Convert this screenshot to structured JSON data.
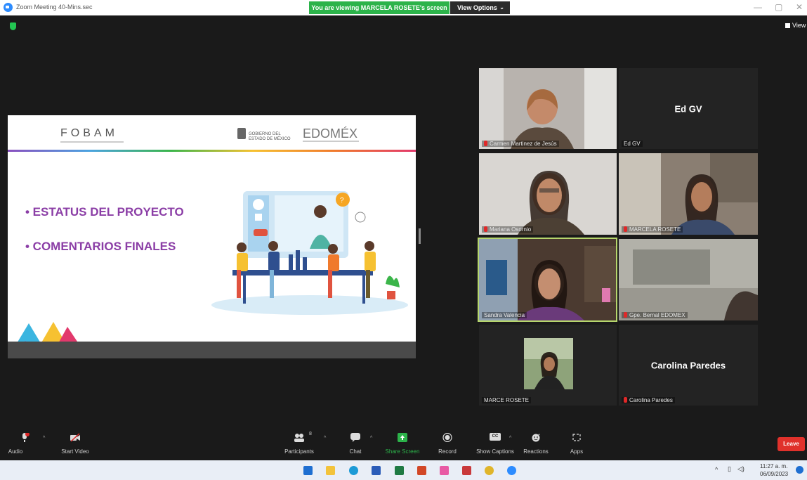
{
  "window": {
    "title": "Zoom Meeting 40-Mins.sec",
    "share_banner": "You are viewing MARCELA ROSETE's screen",
    "view_options": "View Options",
    "view_top": "View"
  },
  "slide": {
    "logo_left": "FOBAM",
    "gov_text_1": "GOBIERNO DEL",
    "gov_text_2": "ESTADO DE MÉXICO",
    "logo_right": "EDOMÉX",
    "bullets": [
      "• ESTATUS DEL PROYECTO",
      "• COMENTARIOS FINALES"
    ]
  },
  "participants": [
    {
      "name": "Carmen Martinez de Jesús",
      "muted": true,
      "video": true
    },
    {
      "name": "Ed GV",
      "display": "Ed GV",
      "muted": false,
      "video": false
    },
    {
      "name": "Mariana Osornio",
      "muted": true,
      "video": true
    },
    {
      "name": "MARCELA ROSETE",
      "muted": true,
      "video": true
    },
    {
      "name": "Sandra Valencia",
      "muted": false,
      "video": true,
      "active": true
    },
    {
      "name": "Gpe. Bernal EDOMEX",
      "muted": true,
      "video": true
    },
    {
      "name": "MARCE ROSETE",
      "muted": false,
      "video": false
    },
    {
      "name": "Carolina Paredes",
      "display": "Carolina Paredes",
      "muted": true,
      "video": false
    }
  ],
  "toolbar": {
    "audio": "Audio",
    "start_video": "Start Video",
    "participants": "Participants",
    "participants_count": "8",
    "chat": "Chat",
    "share_screen": "Share Screen",
    "record": "Record",
    "show_captions": "Show Captions",
    "captions_badge": "CC",
    "reactions": "Reactions",
    "apps": "Apps",
    "leave": "Leave"
  },
  "taskbar": {
    "time": "11:27 a. m.",
    "date": "06/09/2023"
  },
  "colors": {
    "accent_purple": "#8b3ea6",
    "share_green": "#2cb34a",
    "leave_red": "#e0312b"
  }
}
